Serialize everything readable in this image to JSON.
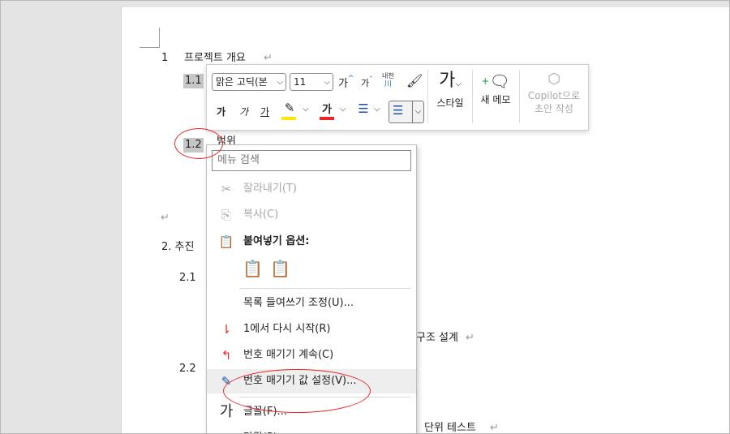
{
  "document": {
    "heading1_num": "1",
    "heading1_text": "프로젝트 개요",
    "item_1_1": "1.1",
    "item_1_2": "1.2",
    "item_1_2_text": "범위",
    "heading2": "2. 추진",
    "item_2_1": "2.1",
    "item_2_2": "2.2",
    "partial_text_1": "구조 설계",
    "partial_text_2": "단위 테스트",
    "para_mark": "↵"
  },
  "mini_toolbar": {
    "font_name": "맑은 고딕(본",
    "font_size": "11",
    "grow_font": "가",
    "shrink_font": "가",
    "phonetic": "내천",
    "bold": "가",
    "italic": "가",
    "underline": "가",
    "font_color": "가",
    "styles_label": "스타일",
    "new_comment_label": "새 메모",
    "copilot_line1": "Copilot으로",
    "copilot_line2": "초안 작성",
    "highlight_color": "#ffe600",
    "font_color_bar": "#e8262b"
  },
  "context_menu": {
    "search_placeholder": "메뉴 검색",
    "cut": "잘라내기(T)",
    "copy": "복사(C)",
    "paste_options": "붙여넣기 옵션:",
    "adjust_list_indent": "목록 들여쓰기 조정(U)...",
    "restart_at_1": "1에서 다시 시작(R)",
    "continue_numbering": "번호 매기기 계속(C)",
    "set_numbering_value": "번호 매기기 값 설정(V)...",
    "font": "글꼴(F)...",
    "paragraph": "단락(P)..."
  },
  "annotation_color": "#e8262b"
}
